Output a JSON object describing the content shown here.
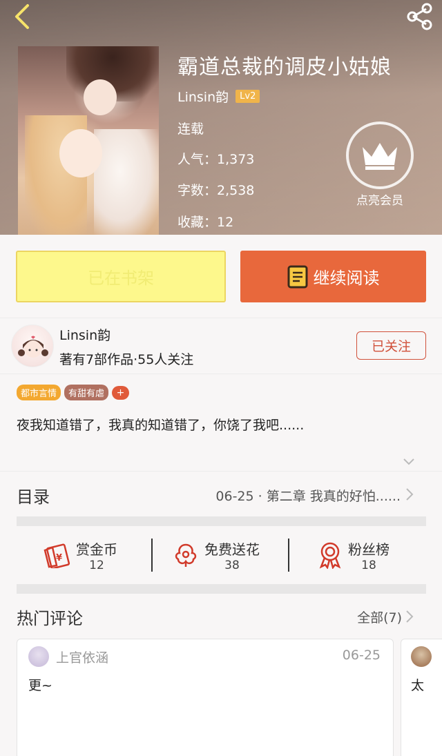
{
  "header": {
    "title": "霸道总裁的调皮小姑娘",
    "author": "Linsin韵",
    "level": "Lv2",
    "status": "连载",
    "popularity": "人气：1,373",
    "word_count": "字数：2,538",
    "favorites": "收藏：12",
    "vip_label": "点亮会员"
  },
  "actions": {
    "shelf_label": "已在书架",
    "read_label": "继续阅读"
  },
  "author_card": {
    "name": "Linsin韵",
    "meta": "著有7部作品·55人关注",
    "follow_label": "已关注"
  },
  "tags": [
    "都市言情",
    "有甜有虐"
  ],
  "tag_add": "+",
  "description": "夜我知道错了，我真的知道错了，你饶了我吧......",
  "catalog": {
    "label": "目录",
    "latest": "06-25 · 第二章 我真的好怕......"
  },
  "stats": {
    "coins_label": "赏金币",
    "coins_value": "12",
    "flowers_label": "免费送花",
    "flowers_value": "38",
    "fans_label": "粉丝榜",
    "fans_value": "18"
  },
  "comments": {
    "title": "热门评论",
    "all_label": "全部(7)",
    "items": [
      {
        "user": "上官依涵",
        "date": "06-25",
        "text": "更~"
      },
      {
        "user": "",
        "date": "",
        "text": "太"
      }
    ]
  },
  "colors": {
    "accent_orange": "#e8683c",
    "shelf_yellow": "#fdf88c",
    "follow_red": "#d0503a",
    "icon_red": "#d13a2a"
  },
  "icons": [
    "back-arrow-icon",
    "share-icon",
    "crown-icon",
    "book-icon",
    "chevron-down-icon",
    "chevron-right-icon",
    "red-envelope-icon",
    "flower-icon",
    "ribbon-medal-icon"
  ]
}
